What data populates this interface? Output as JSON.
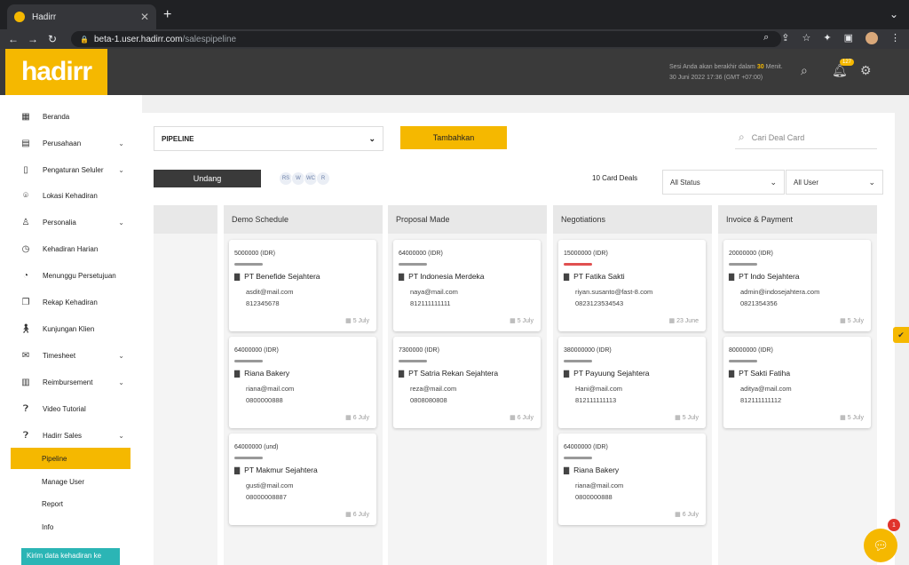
{
  "browser": {
    "tab_title": "Hadirr",
    "url_host": "beta-1.user.hadirr.com",
    "url_path": "/salespipeline"
  },
  "header": {
    "logo_text": "hadirr",
    "session_prefix": "Sesi Anda akan berakhir dalam",
    "session_minutes": "30",
    "session_suffix": "Menit.",
    "datetime": "30 Juni 2022 17:36 (GMT +07:00)",
    "notif_count": "127"
  },
  "sidebar": {
    "items": [
      {
        "label": "Beranda",
        "icon": "home-icon"
      },
      {
        "label": "Perusahaan",
        "icon": "building-icon"
      },
      {
        "label": "Pengaturan Seluler",
        "icon": "phone-icon"
      },
      {
        "label": "Lokasi Kehadiran",
        "icon": "location-icon"
      },
      {
        "label": "Personalia",
        "icon": "person-icon"
      },
      {
        "label": "Kehadiran Harian",
        "icon": "clock-icon"
      },
      {
        "label": "Menunggu Persetujuan",
        "icon": "pending-icon"
      },
      {
        "label": "Rekap Kehadiran",
        "icon": "copy-icon"
      },
      {
        "label": "Kunjungan Klien",
        "icon": "walk-icon"
      },
      {
        "label": "Timesheet",
        "icon": "mail-icon"
      },
      {
        "label": "Reimbursement",
        "icon": "receipt-icon"
      },
      {
        "label": "Video Tutorial",
        "icon": "help-icon"
      },
      {
        "label": "Hadirr Sales",
        "icon": "help-icon"
      }
    ],
    "sub_items": [
      "Pipeline",
      "Manage User",
      "Report",
      "Info"
    ],
    "kirim_label": "Kirim data kehadiran ke"
  },
  "toolbar": {
    "pipeline_select": "PIPELINE",
    "tambah_label": "Tambahkan",
    "search_placeholder": "Cari Deal Card",
    "undang_label": "Undang",
    "avatars": [
      "RS",
      "W",
      "WC",
      "R"
    ],
    "card_count": "10 Card Deals",
    "status_filter": "All Status",
    "user_filter": "All User"
  },
  "columns": [
    {
      "title": "Demo Schedule",
      "cards": [
        {
          "amount": "5000000 (IDR)",
          "company": "PT Benefide Sejahtera",
          "email": "asdit@mail.com",
          "phone": "812345678",
          "date": "5 July",
          "bar": "gray"
        },
        {
          "amount": "64000000 (IDR)",
          "company": "Riana Bakery",
          "email": "riana@mail.com",
          "phone": "0800000888",
          "date": "6 July",
          "bar": "gray"
        },
        {
          "amount": "64000000 (und)",
          "company": "PT Makmur Sejahtera",
          "email": "gusti@mail.com",
          "phone": "08000008887",
          "date": "6 July",
          "bar": "gray"
        }
      ]
    },
    {
      "title": "Proposal Made",
      "cards": [
        {
          "amount": "64000000 (IDR)",
          "company": "PT Indonesia Merdeka",
          "email": "naya@mail.com",
          "phone": "812111111111",
          "date": "5 July",
          "bar": "gray"
        },
        {
          "amount": "7300000 (IDR)",
          "company": "PT Satria Rekan Sejahtera",
          "email": "reza@mail.com",
          "phone": "0808080808",
          "date": "6 July",
          "bar": "gray"
        }
      ]
    },
    {
      "title": "Negotiations",
      "cards": [
        {
          "amount": "15000000 (IDR)",
          "company": "PT Fatika Sakti",
          "email": "riyan.susanto@fast-8.com",
          "phone": "0823123534543",
          "date": "23 June",
          "bar": "red"
        },
        {
          "amount": "380000000 (IDR)",
          "company": "PT Payuung Sejahtera",
          "email": "Hani@mail.com",
          "phone": "812111111113",
          "date": "5 July",
          "bar": "gray"
        },
        {
          "amount": "64000000 (IDR)",
          "company": "Riana Bakery",
          "email": "riana@mail.com",
          "phone": "0800000888",
          "date": "6 July",
          "bar": "gray"
        }
      ]
    },
    {
      "title": "Invoice & Payment",
      "cards": [
        {
          "amount": "20000000 (IDR)",
          "company": "PT Indo Sejahtera",
          "email": "admin@indosejahtera.com",
          "phone": "0821354356",
          "date": "5 July",
          "bar": "gray"
        },
        {
          "amount": "80000000 (IDR)",
          "company": "PT Sakti Fatiha",
          "email": "aditya@mail.com",
          "phone": "812111111112",
          "date": "5 July",
          "bar": "gray"
        }
      ]
    }
  ],
  "chat": {
    "badge": "1"
  },
  "colors": {
    "accent": "#f5b800",
    "dark": "#3a3a3a",
    "teal": "#2bb5b5",
    "red_bar": "#e05050"
  }
}
